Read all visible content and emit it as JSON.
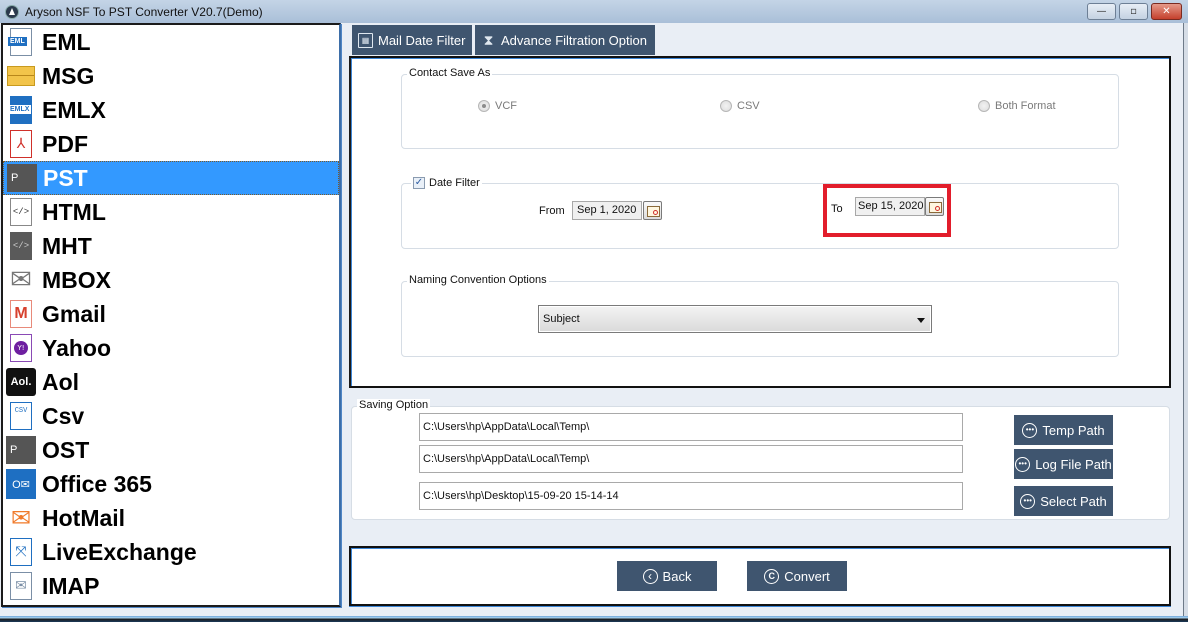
{
  "window": {
    "title": "Aryson NSF To PST Converter V20.7(Demo)",
    "controls": {
      "minimize": "—",
      "restore": "▫",
      "close": "✕"
    }
  },
  "sidebar": {
    "selected": "PST",
    "items": [
      {
        "label": "EML",
        "icon": "eml-file-icon"
      },
      {
        "label": "MSG",
        "icon": "envelope-icon"
      },
      {
        "label": "EMLX",
        "icon": "emlx-file-icon"
      },
      {
        "label": "PDF",
        "icon": "pdf-file-icon"
      },
      {
        "label": "PST",
        "icon": "pst-outlook-icon"
      },
      {
        "label": "HTML",
        "icon": "html-file-icon"
      },
      {
        "label": "MHT",
        "icon": "mht-file-icon"
      },
      {
        "label": "MBOX",
        "icon": "mbox-envelope-icon"
      },
      {
        "label": "Gmail",
        "icon": "gmail-icon"
      },
      {
        "label": "Yahoo",
        "icon": "yahoo-icon"
      },
      {
        "label": "Aol",
        "icon": "aol-icon"
      },
      {
        "label": "Csv",
        "icon": "csv-file-icon"
      },
      {
        "label": "OST",
        "icon": "ost-outlook-icon"
      },
      {
        "label": "Office 365",
        "icon": "office365-icon"
      },
      {
        "label": "HotMail",
        "icon": "hotmail-icon"
      },
      {
        "label": "LiveExchange",
        "icon": "exchange-icon"
      },
      {
        "label": "IMAP",
        "icon": "imap-envelope-icon"
      }
    ],
    "icon_text": {
      "eml": "EML",
      "emlx": "EMLX",
      "pdf": "⅄",
      "pst": "P",
      "html": "</>",
      "mht": "</>",
      "gmail": "M",
      "yahoo": "Y!",
      "aol": "Aol.",
      "csv": "CSV",
      "ost": "P",
      "o365": "O✉",
      "hotmail": "✉",
      "exchange": "⤧",
      "imap": "✉",
      "mbox": "✉"
    }
  },
  "tabs": [
    {
      "label": "Mail Date Filter",
      "icon": "calendar-icon"
    },
    {
      "label": "Advance Filtration Option",
      "icon": "hourglass-icon"
    }
  ],
  "contact_save_as": {
    "legend": "Contact Save As",
    "options": [
      {
        "label": "VCF",
        "selected": true
      },
      {
        "label": "CSV",
        "selected": false
      },
      {
        "label": "Both Format",
        "selected": false
      }
    ]
  },
  "date_filter": {
    "label": "Date Filter",
    "checked": true,
    "checkmark": "✓",
    "from_label": "From",
    "from_value": "Sep 1, 2020",
    "to_label": "To",
    "to_value": "Sep 15, 2020"
  },
  "naming_convention": {
    "legend": "Naming Convention Options",
    "selected": "Subject"
  },
  "saving_option": {
    "legend": "Saving Option",
    "temp_path": "C:\\Users\\hp\\AppData\\Local\\Temp\\",
    "log_file_path": "C:\\Users\\hp\\AppData\\Local\\Temp\\",
    "select_path": "C:\\Users\\hp\\Desktop\\15-09-20 15-14-14",
    "buttons": {
      "temp_path": "Temp Path",
      "log_file_path": "Log File Path",
      "select_path": "Select Path",
      "icon_glyph": "•••"
    }
  },
  "footer": {
    "back_label": "Back",
    "back_icon": "‹",
    "convert_label": "Convert",
    "convert_icon": "C"
  },
  "colors": {
    "accent_dark": "#3f556f",
    "selection": "#3399ff",
    "highlight": "#e21d2b"
  }
}
